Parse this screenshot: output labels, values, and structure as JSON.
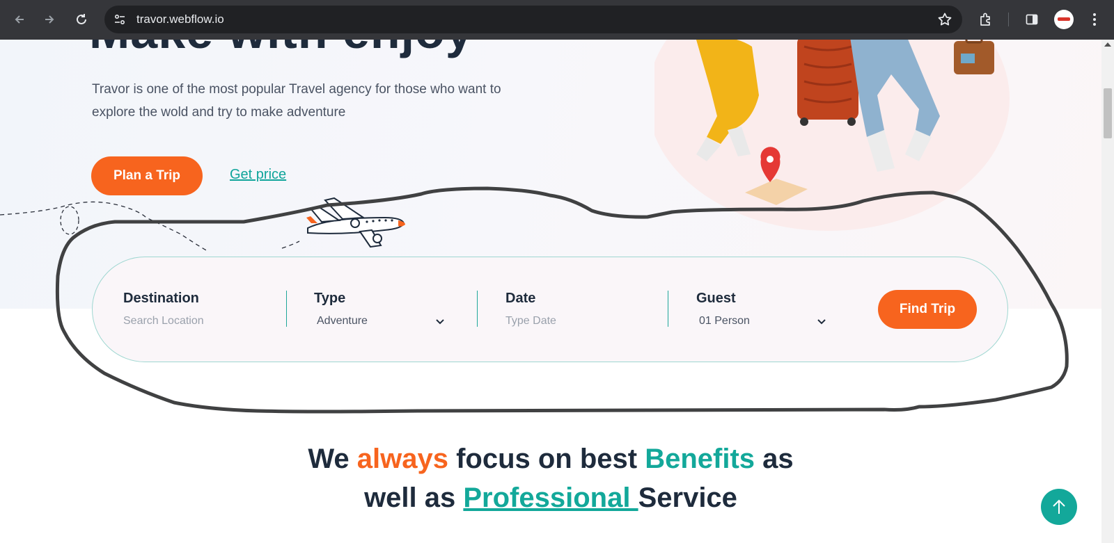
{
  "browser": {
    "url": "travor.webflow.io",
    "icons": [
      "back-icon",
      "forward-icon",
      "reload-icon",
      "site-settings-icon",
      "bookmark-star-icon",
      "extensions-icon",
      "side-panel-icon",
      "profile-avatar",
      "menu-kebab-icon"
    ]
  },
  "hero": {
    "title_fragment": "Make with enjoy",
    "description": "Travor is one of the most popular Travel agency for those who want to explore the wold and try to make adventure",
    "primary_cta": "Plan a Trip",
    "secondary_cta": "Get price"
  },
  "search": {
    "fields": [
      {
        "label": "Destination",
        "value": "Search Location",
        "kind": "input"
      },
      {
        "label": "Type",
        "value": "Adventure",
        "kind": "select"
      },
      {
        "label": "Date",
        "value": "Type Date",
        "kind": "input"
      },
      {
        "label": "Guest",
        "value": "01 Person",
        "kind": "select"
      }
    ],
    "submit_label": "Find Trip"
  },
  "section": {
    "heading_parts": {
      "p1": "We ",
      "p2": "always",
      "p3": " focus on best ",
      "p4": "Benefits",
      "p5": " as",
      "p6": "well as ",
      "p7": "Professional ",
      "p8": "Service"
    }
  },
  "colors": {
    "accent_orange": "#f7641e",
    "accent_teal": "#13a89a",
    "heading_dark": "#1e2b3c"
  }
}
